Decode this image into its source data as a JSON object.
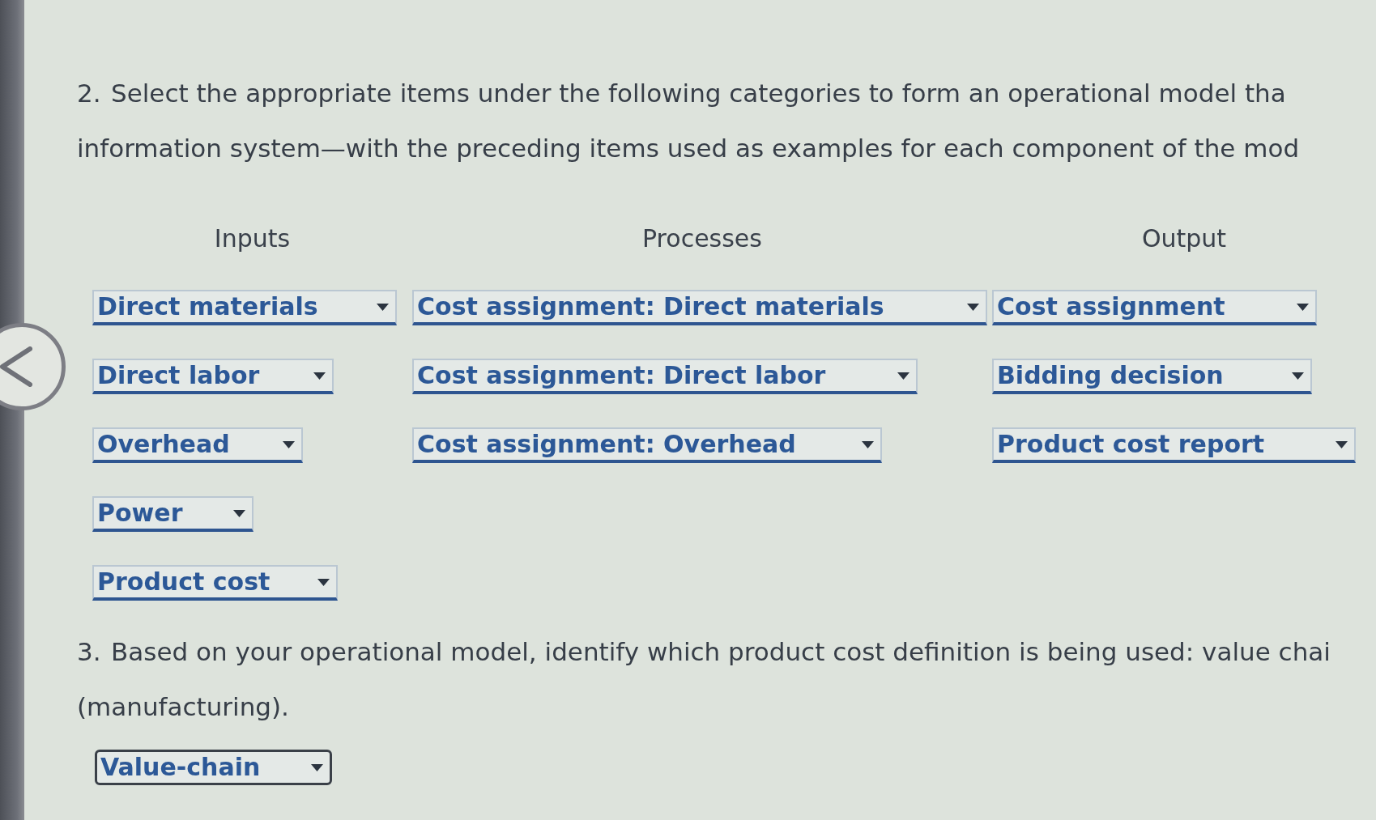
{
  "question_2": {
    "number": "2.",
    "lines": [
      "Select the appropriate items under the following categories to form an operational model tha",
      "information system—with the preceding items used as examples for each component of the mod"
    ],
    "columns": [
      {
        "heading": "Inputs",
        "dropdowns": [
          {
            "value": "Direct materials",
            "focused": false
          },
          {
            "value": "Direct labor",
            "focused": false
          },
          {
            "value": "Overhead",
            "focused": false
          },
          {
            "value": "Power",
            "focused": false
          },
          {
            "value": "Product cost",
            "focused": false
          }
        ]
      },
      {
        "heading": "Processes",
        "dropdowns": [
          {
            "value": "Cost assignment: Direct materials",
            "focused": false
          },
          {
            "value": "Cost assignment: Direct labor",
            "focused": false
          },
          {
            "value": "Cost assignment: Overhead",
            "focused": false
          }
        ]
      },
      {
        "heading": "Output",
        "dropdowns": [
          {
            "value": "Cost assignment",
            "focused": false
          },
          {
            "value": "Bidding decision",
            "focused": false
          },
          {
            "value": "Product cost report",
            "focused": false
          }
        ]
      }
    ]
  },
  "question_3": {
    "number": "3.",
    "lines": [
      "Based on your operational model, identify which product cost definition is being used: value chai",
      "(manufacturing)."
    ],
    "dropdown": {
      "value": "Value-chain",
      "focused": true
    }
  }
}
